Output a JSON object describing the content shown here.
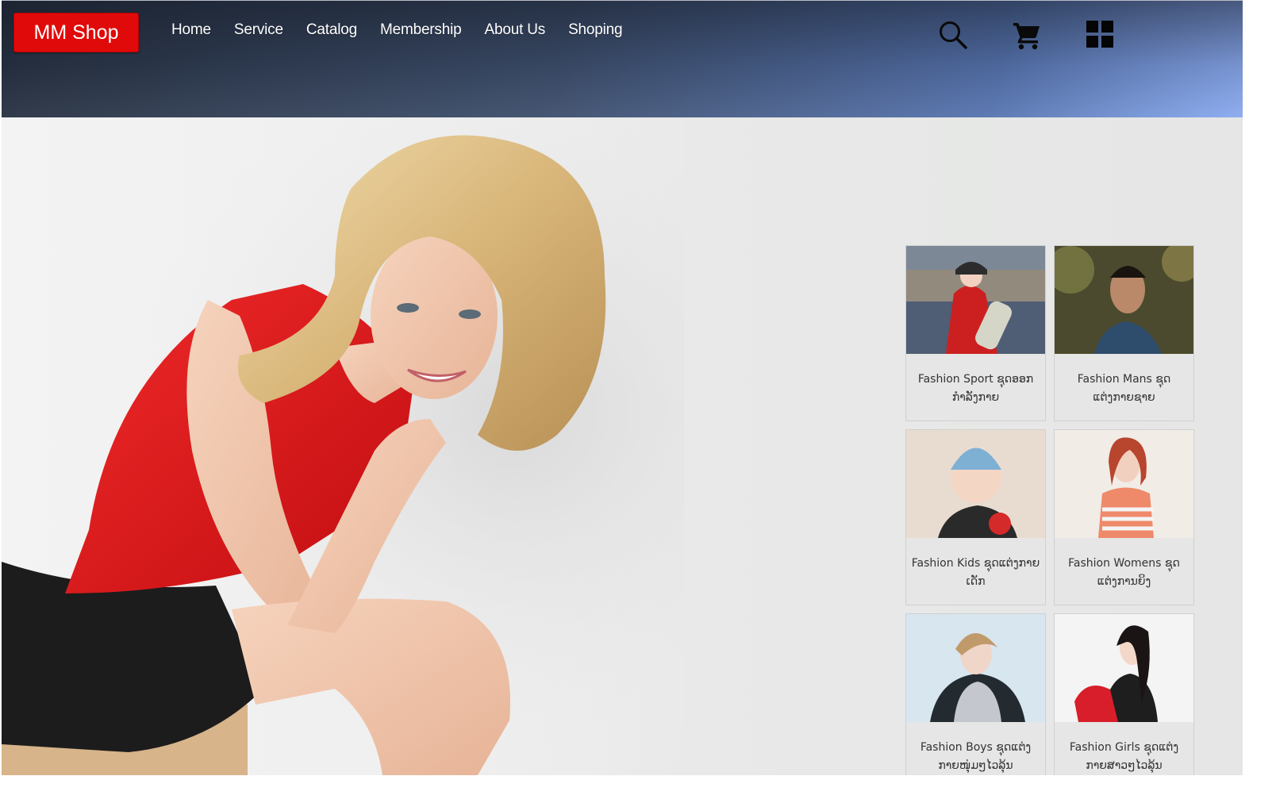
{
  "header": {
    "logo": "MM Shop",
    "nav": [
      "Home",
      "Service",
      "Catalog",
      "Membership",
      "About Us",
      "Shoping"
    ],
    "icons": [
      "search-icon",
      "cart-icon",
      "grid-icon"
    ]
  },
  "hero": {
    "image": "woman-red-top-photo"
  },
  "categories": [
    {
      "name": "Fashion Sport ຊຸດອອກກຳລັງກາຍ",
      "image": "sport-photo"
    },
    {
      "name": "Fashion Mans ຊຸດແຕ່ງກາຍຊາຍ",
      "image": "man-photo"
    },
    {
      "name": "Fashion Kids ຊຸດແຕ່ງກາຍເດັກ",
      "image": "kid-photo"
    },
    {
      "name": "Fashion Womens ຊຸດແຕ່ງການຍິງ",
      "image": "woman-photo"
    },
    {
      "name": "Fashion Boys ຊຸດແຕ່ງກາຍໜຸ່ມໆໄວລຸ້ນ",
      "image": "boy-photo"
    },
    {
      "name": "Fashion Girls ຊຸດແຕ່ງກາຍສາວໆໄວລຸ້ນ",
      "image": "girl-photo"
    }
  ],
  "colors": {
    "logo_bg": "#e00a0a",
    "header_dark": "#263040",
    "header_light": "#8aaaf0",
    "page_bg": "#e5e6e5"
  }
}
